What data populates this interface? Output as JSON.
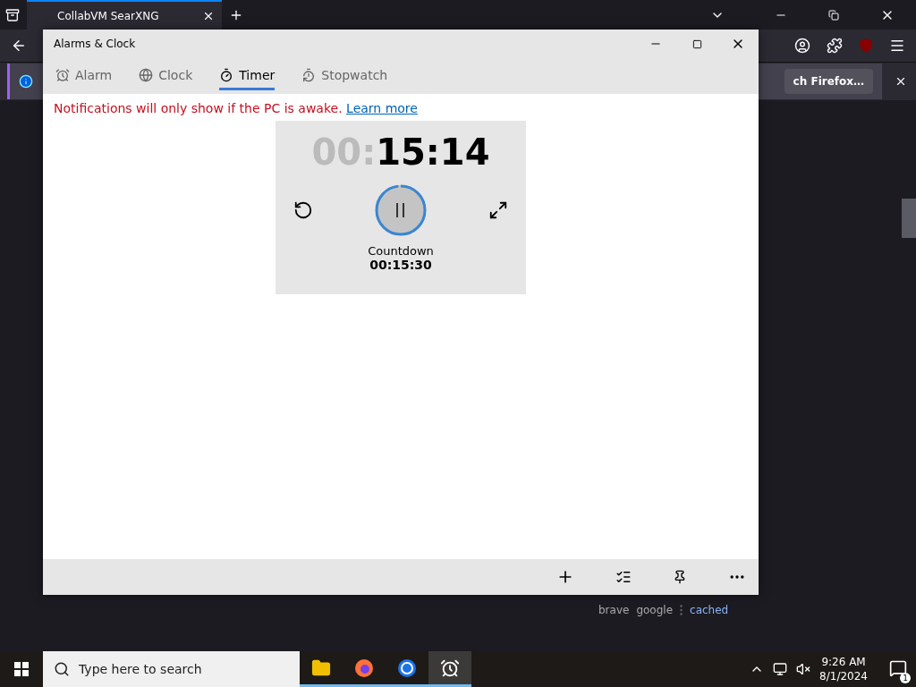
{
  "browser": {
    "tab_title": "CollabVM SearXNG",
    "notification": "ch Firefox…",
    "result_links": [
      {
        "label": "brave",
        "kind": "engine"
      },
      {
        "label": "google",
        "kind": "engine"
      },
      {
        "label": "cached",
        "kind": "link"
      }
    ]
  },
  "app_window": {
    "title": "Alarms & Clock",
    "tabs": [
      {
        "label": "Alarm",
        "kind": "alarm",
        "selected": false
      },
      {
        "label": "Clock",
        "kind": "clock",
        "selected": false
      },
      {
        "label": "Timer",
        "kind": "timer",
        "selected": true
      },
      {
        "label": "Stopwatch",
        "kind": "stopwatch",
        "selected": false
      }
    ],
    "notice": "Notifications will only show if the PC is awake.",
    "notice_link": "Learn more",
    "timer": {
      "hours": "00:",
      "remaining": "15:14",
      "running": true,
      "level": 0.98,
      "label": "Countdown",
      "duration": "00:15:30"
    }
  },
  "taskbar": {
    "search_placeholder": "Type here to search",
    "apps": [
      {
        "kind": "folder",
        "selected": false
      },
      {
        "kind": "firefox",
        "selected": false
      },
      {
        "kind": "browser",
        "selected": false
      },
      {
        "kind": "alarms",
        "selected": true
      }
    ],
    "time": "9:26 AM",
    "date": "8/1/2024",
    "notification_count": "1"
  }
}
